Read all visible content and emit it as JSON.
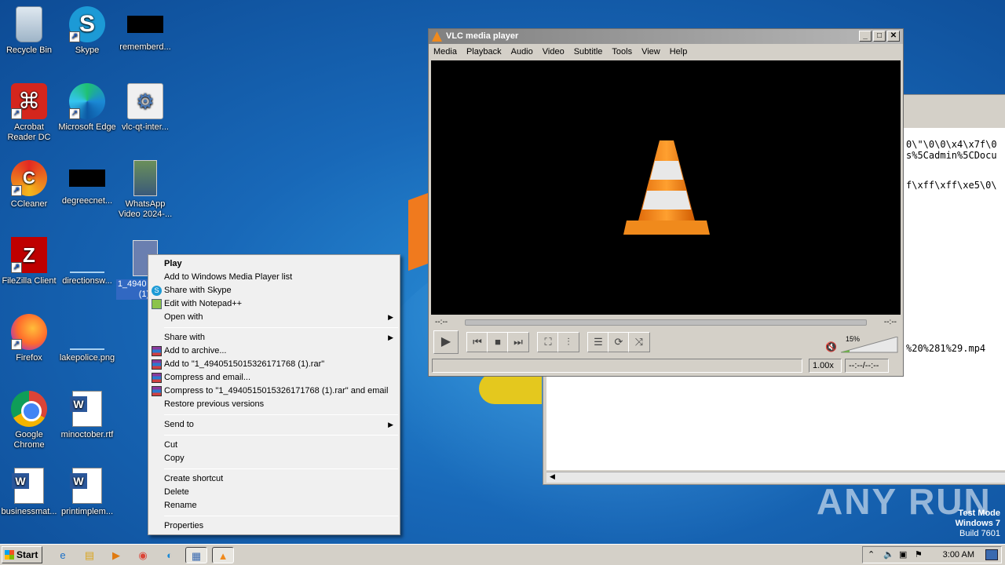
{
  "desktop": {
    "icons": [
      {
        "label": "Recycle Bin"
      },
      {
        "label": "Skype"
      },
      {
        "label": "rememberd..."
      },
      {
        "label": "Acrobat Reader DC"
      },
      {
        "label": "Microsoft Edge"
      },
      {
        "label": "vlc-qt-inter..."
      },
      {
        "label": "CCleaner"
      },
      {
        "label": "degreecnet..."
      },
      {
        "label": "WhatsApp Video 2024-..."
      },
      {
        "label": "FileZilla Client"
      },
      {
        "label": "directionsw..."
      },
      {
        "label": "1_4940 53261 (1)."
      },
      {
        "label": "Firefox"
      },
      {
        "label": "lakepolice.png"
      },
      {
        "label": "Google Chrome"
      },
      {
        "label": "minoctober.rtf"
      },
      {
        "label": "businessmat..."
      },
      {
        "label": "printimplem..."
      }
    ]
  },
  "context_menu": {
    "items": [
      {
        "label": "Play"
      },
      {
        "label": "Add to Windows Media Player list"
      },
      {
        "label": "Share with Skype"
      },
      {
        "label": "Edit with Notepad++"
      },
      {
        "label": "Open with"
      },
      {
        "label": "Share with"
      },
      {
        "label": "Add to archive..."
      },
      {
        "label": "Add to \"1_4940515015326171768 (1).rar\""
      },
      {
        "label": "Compress and email..."
      },
      {
        "label": "Compress to \"1_4940515015326171768 (1).rar\" and email"
      },
      {
        "label": "Restore previous versions"
      },
      {
        "label": "Send to"
      },
      {
        "label": "Cut"
      },
      {
        "label": "Copy"
      },
      {
        "label": "Create shortcut"
      },
      {
        "label": "Delete"
      },
      {
        "label": "Rename"
      },
      {
        "label": "Properties"
      }
    ]
  },
  "vlc": {
    "title": "VLC media player",
    "menu": [
      "Media",
      "Playback",
      "Audio",
      "Video",
      "Subtitle",
      "Tools",
      "View",
      "Help"
    ],
    "time_left": "--:--",
    "time_right": "--:--",
    "volume": "15%",
    "speed": "1.00x",
    "time_total": "--:--/--:--"
  },
  "bg_window": {
    "lines": [
      "0\\\"\\0\\0\\x4\\x7f\\0",
      "s%5Cadmin%5CDocu",
      "f\\xff\\xff\\xe5\\0\\",
      "%20%281%29.mp4"
    ]
  },
  "watermark": {
    "text": "ANY RUN"
  },
  "os_info": {
    "mode": "Test Mode",
    "version": "Windows 7",
    "build": "Build 7601"
  },
  "taskbar": {
    "start_label": "Start",
    "clock": "3:00 AM"
  }
}
